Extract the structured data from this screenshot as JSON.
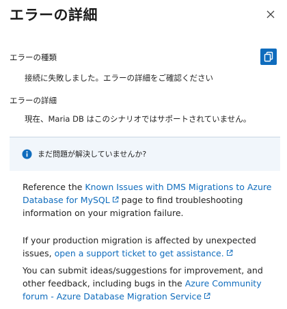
{
  "panel": {
    "title": "エラーの詳細"
  },
  "error": {
    "type_label": "エラーの種類",
    "type_value": "接続に失敗しました。エラーの詳細をご確認ください",
    "detail_label": "エラーの詳細",
    "detail_value": "現在、Maria DB はこのシナリオではサポートされていません。"
  },
  "info": {
    "message": "まだ問題が解決していませんか?"
  },
  "help": {
    "p1_before": "Reference the ",
    "p1_link": "Known Issues with DMS Migrations to Azure Database for MySQL",
    "p1_after": " page to find troubleshooting information on your migration failure.",
    "p2_before": "If your production migration is affected by unexpected issues, ",
    "p2_link": "open a support ticket to get assistance.",
    "p3_before": "You can submit ideas/suggestions for improvement, and other feedback, including bugs in the ",
    "p3_link": "Azure Community forum - Azure Database Migration Service"
  },
  "icons": {
    "close": "close-icon",
    "copy": "copy-icon",
    "info": "info-icon",
    "external": "external-link-icon"
  },
  "colors": {
    "accent": "#0f6cbd",
    "info_bg": "#f1f6fb"
  }
}
